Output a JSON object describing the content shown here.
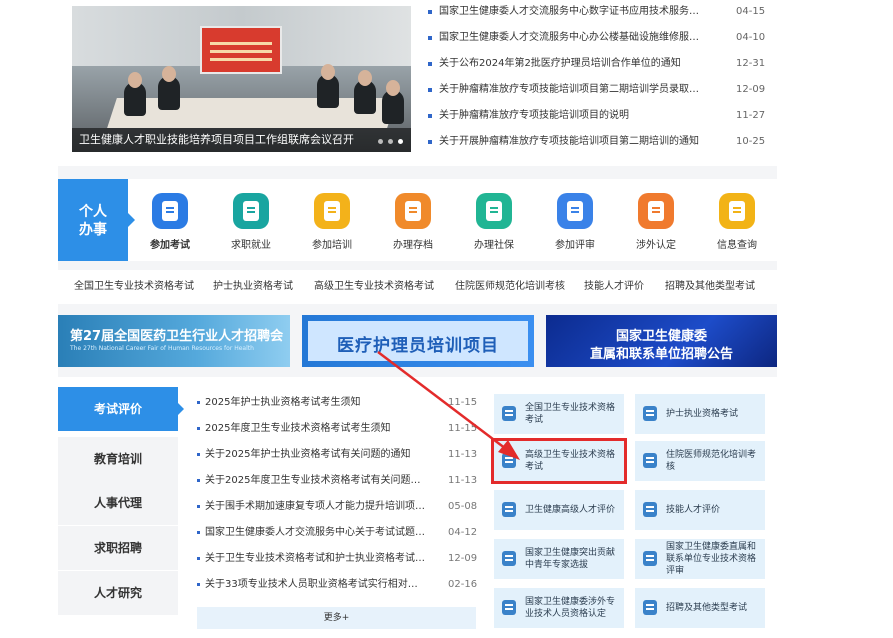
{
  "featured": {
    "caption": "卫生健康人才职业技能培养项目项目工作组联席会议召开",
    "screen_text": "",
    "slides": 3,
    "active_slide": 3
  },
  "news": [
    {
      "title": "国家卫生健康委人才交流服务中心数字证书应用技术服务采...",
      "date": "04-15"
    },
    {
      "title": "国家卫生健康委人才交流服务中心办公楼基础设施维修服务...",
      "date": "04-10"
    },
    {
      "title": "关于公布2024年第2批医疗护理员培训合作单位的通知",
      "date": "12-31"
    },
    {
      "title": "关于肿瘤精准放疗专项技能培训项目第二期培训学员录取情...",
      "date": "12-09"
    },
    {
      "title": "关于肿瘤精准放疗专项技能培训项目的说明",
      "date": "11-27"
    },
    {
      "title": "关于开展肿瘤精准放疗专项技能培训项目第二期培训的通知",
      "date": "10-25"
    }
  ],
  "services": {
    "title_line1": "个人",
    "title_line2": "办事",
    "items": [
      {
        "label": "参加考试",
        "color": "#2b7be4",
        "icon": "exam-icon"
      },
      {
        "label": "求职就业",
        "color": "#19a5a0",
        "icon": "job-icon"
      },
      {
        "label": "参加培训",
        "color": "#f3b21a",
        "icon": "training-icon"
      },
      {
        "label": "办理存档",
        "color": "#f08a2b",
        "icon": "archive-icon"
      },
      {
        "label": "办理社保",
        "color": "#21b594",
        "icon": "social-security-icon"
      },
      {
        "label": "参加评审",
        "color": "#3a82e8",
        "icon": "review-icon"
      },
      {
        "label": "涉外认定",
        "color": "#f07a2e",
        "icon": "foreign-icon"
      },
      {
        "label": "信息查询",
        "color": "#f2b316",
        "icon": "query-icon"
      }
    ]
  },
  "categories": [
    "全国卫生专业技术资格考试",
    "护士执业资格考试",
    "高级卫生专业技术资格考试",
    "住院医师规范化培训考核",
    "技能人才评价",
    "招聘及其他类型考试"
  ],
  "banners": {
    "b1_title": "第27届全国医药卫生行业人才招聘会",
    "b1_sub": "The 27th National Career Fair of Human Resources for Health",
    "b2_title": "医疗护理员培训项目",
    "b3_line1": "国家卫生健康委",
    "b3_line2": "直属和联系单位招聘公告"
  },
  "side_nav": [
    {
      "label": "考试评价",
      "active": true
    },
    {
      "label": "教育培训",
      "active": false
    },
    {
      "label": "人事代理",
      "active": false
    },
    {
      "label": "求职招聘",
      "active": false
    },
    {
      "label": "人才研究",
      "active": false
    }
  ],
  "notices": [
    {
      "title": "2025年护士执业资格考试考生须知",
      "date": "11-15"
    },
    {
      "title": "2025年度卫生专业技术资格考试考生须知",
      "date": "11-15"
    },
    {
      "title": "关于2025年护士执业资格考试有关问题的通知",
      "date": "11-13"
    },
    {
      "title": "关于2025年度卫生专业技术资格考试有关问题的通...",
      "date": "11-13"
    },
    {
      "title": "关于围手术期加速康复专项人才能力提升培训项目...",
      "date": "05-08"
    },
    {
      "title": "国家卫生健康委人才交流服务中心关于考试试题版...",
      "date": "04-12"
    },
    {
      "title": "关于卫生专业技术资格考试和护士执业资格考试的...",
      "date": "12-09"
    },
    {
      "title": "关于33项专业技术人员职业资格考试实行相对固定...",
      "date": "02-16"
    }
  ],
  "more_label": "更多+",
  "exam_cards": [
    {
      "label": "全国卫生专业技术资格考试"
    },
    {
      "label": "护士执业资格考试"
    },
    {
      "label": "高级卫生专业技术资格考试",
      "highlighted": true
    },
    {
      "label": "住院医师规范化培训考核"
    },
    {
      "label": "卫生健康高级人才评价"
    },
    {
      "label": "技能人才评价"
    },
    {
      "label": "国家卫生健康突出贡献中青年专家选拔"
    },
    {
      "label": "国家卫生健康委直属和联系单位专业技术资格评审"
    },
    {
      "label": "国家卫生健康委涉外专业技术人员资格认定"
    },
    {
      "label": "招聘及其他类型考试"
    }
  ],
  "colors": {
    "primary": "#2d8fe7",
    "annotation": "#e32b2b",
    "card_bg": "#e3f1fb"
  }
}
